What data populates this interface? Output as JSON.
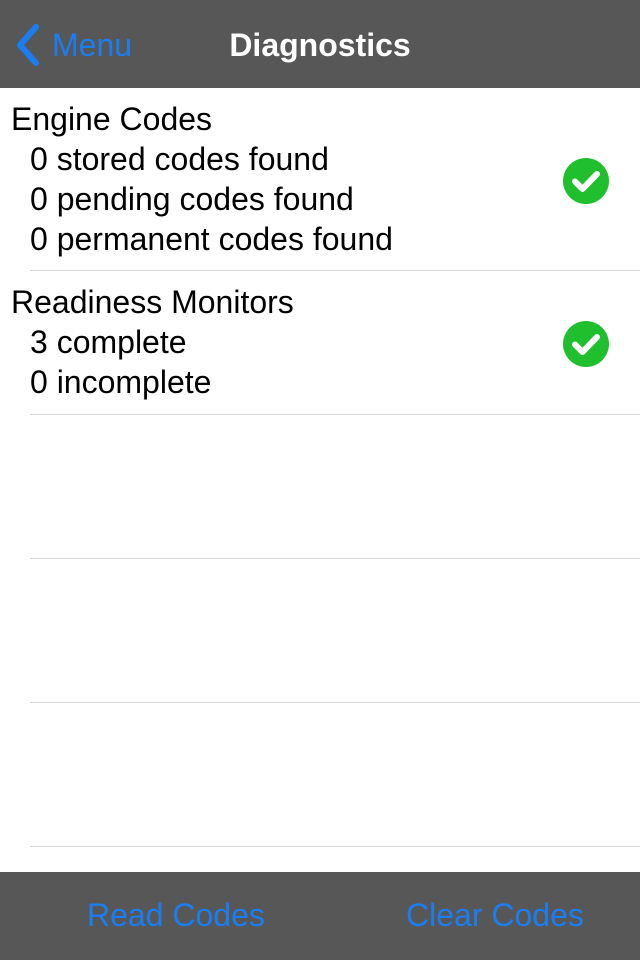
{
  "navbar": {
    "back_label": "Menu",
    "back_icon": "chevron-left-icon",
    "title": "Diagnostics"
  },
  "sections": {
    "engine": {
      "title": "Engine Codes",
      "lines": [
        "0 stored codes found",
        "0 pending codes found",
        "0 permanent codes found"
      ],
      "status_icon": "check-circle-icon"
    },
    "readiness": {
      "title": "Readiness Monitors",
      "lines": [
        "3 complete",
        "0 incomplete"
      ],
      "status_icon": "check-circle-icon"
    }
  },
  "toolbar": {
    "read_label": "Read Codes",
    "clear_label": "Clear Codes"
  },
  "colors": {
    "bar_background": "#575757",
    "accent_blue": "#1a7ef2",
    "status_green": "#1fbf2e",
    "separator": "#d4d4d4"
  }
}
